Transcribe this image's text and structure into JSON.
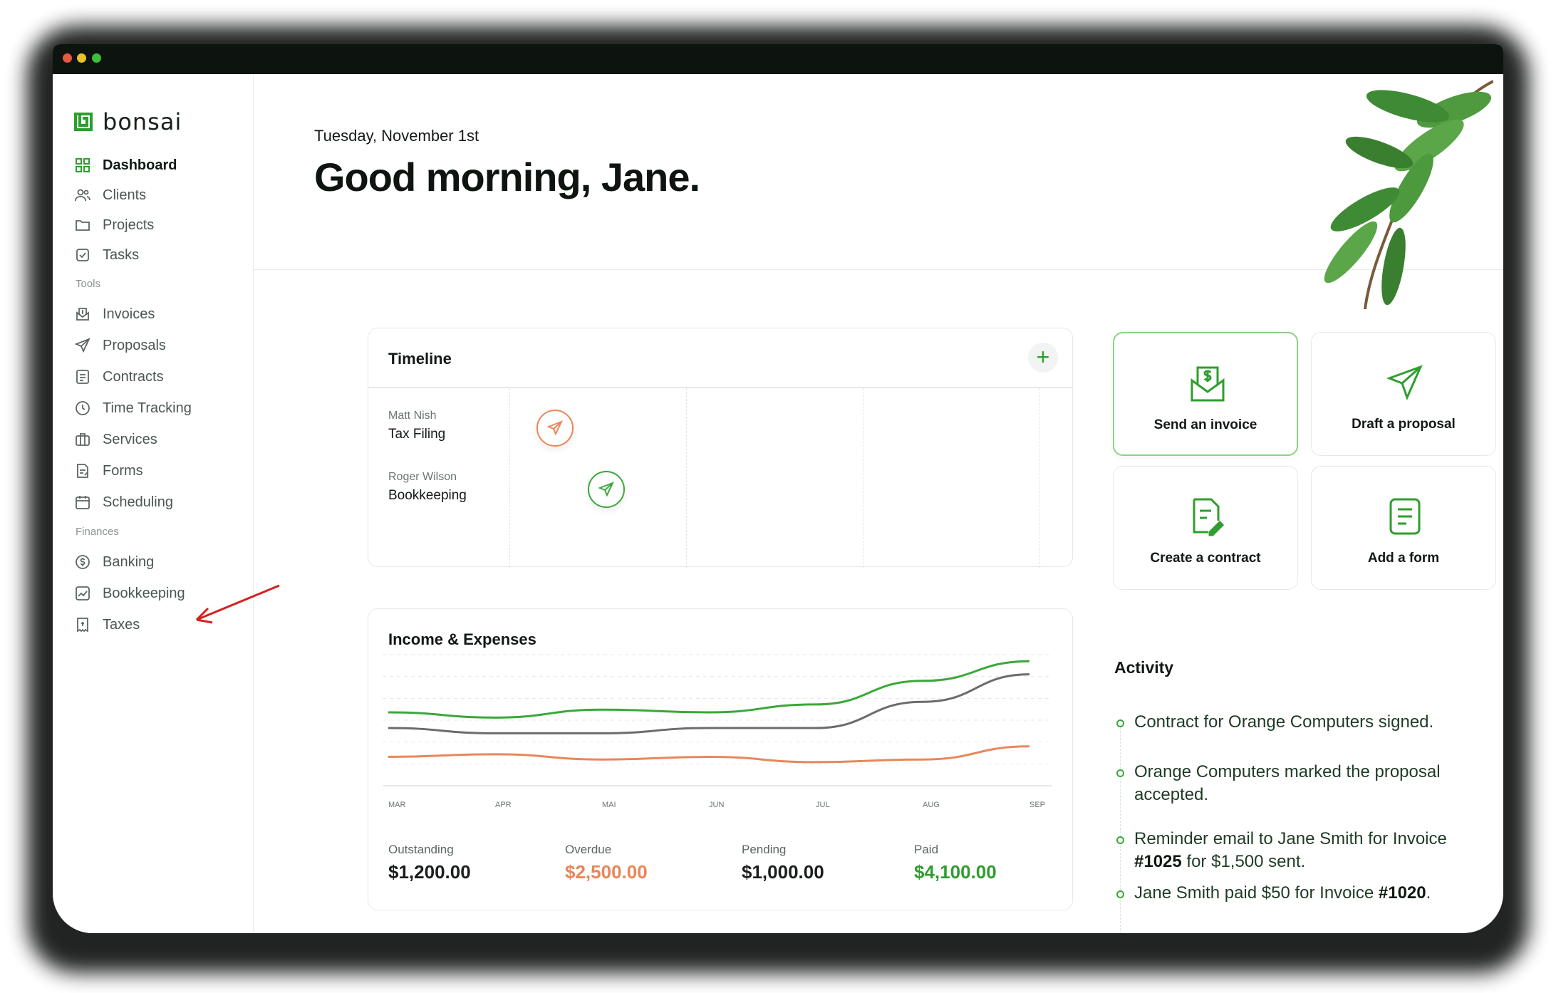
{
  "app": {
    "logo_text": "bonsai",
    "brand_color": "#2e9e2e"
  },
  "sidebar": {
    "main_items": [
      {
        "label": "Dashboard",
        "icon": "grid-icon",
        "active": true
      },
      {
        "label": "Clients",
        "icon": "users-icon"
      },
      {
        "label": "Projects",
        "icon": "folder-icon"
      },
      {
        "label": "Tasks",
        "icon": "checkbox-icon"
      }
    ],
    "tools_label": "Tools",
    "tools_items": [
      {
        "label": "Invoices",
        "icon": "invoice-icon"
      },
      {
        "label": "Proposals",
        "icon": "send-icon"
      },
      {
        "label": "Contracts",
        "icon": "document-icon"
      },
      {
        "label": "Time Tracking",
        "icon": "clock-icon"
      },
      {
        "label": "Services",
        "icon": "briefcase-icon"
      },
      {
        "label": "Forms",
        "icon": "form-icon"
      },
      {
        "label": "Scheduling",
        "icon": "calendar-icon"
      }
    ],
    "finances_label": "Finances",
    "finances_items": [
      {
        "label": "Banking",
        "icon": "dollar-circle-icon"
      },
      {
        "label": "Bookkeeping",
        "icon": "chart-icon"
      },
      {
        "label": "Taxes",
        "icon": "receipt-icon"
      }
    ]
  },
  "header": {
    "date": "Tuesday, November 1st",
    "greeting": "Good morning, Jane."
  },
  "timeline": {
    "title": "Timeline",
    "add_label": "+",
    "entries": [
      {
        "client": "Matt Nish",
        "task": "Tax Filing",
        "color": "#e8875a"
      },
      {
        "client": "Roger Wilson",
        "task": "Bookkeeping",
        "color": "#3aa83a"
      }
    ]
  },
  "income": {
    "title": "Income & Expenses",
    "stats": [
      {
        "label": "Outstanding",
        "value": "$1,200.00",
        "color": "#0f1a13"
      },
      {
        "label": "Overdue",
        "value": "$2,500.00",
        "color": "#e8875a"
      },
      {
        "label": "Pending",
        "value": "$1,000.00",
        "color": "#0f1a13"
      },
      {
        "label": "Paid",
        "value": "$4,100.00",
        "color": "#2e9e2e"
      }
    ]
  },
  "chart_data": {
    "type": "line",
    "x": [
      "MAR",
      "APR",
      "MAI",
      "JUN",
      "JUL",
      "AUG",
      "SEP"
    ],
    "series": [
      {
        "color": "#3aa83a",
        "values": [
          56,
          52,
          58,
          56,
          62,
          80,
          95
        ]
      },
      {
        "color": "#6a6d6b",
        "values": [
          44,
          40,
          40,
          44,
          44,
          64,
          85
        ]
      },
      {
        "color": "#e8875a",
        "values": [
          22,
          24,
          20,
          22,
          18,
          20,
          30
        ]
      }
    ],
    "ylim": [
      0,
      100
    ],
    "grid": true
  },
  "actions": [
    {
      "label": "Send an invoice",
      "icon": "invoice-send-icon",
      "primary": true
    },
    {
      "label": "Draft a proposal",
      "icon": "paper-plane-icon",
      "primary": false
    },
    {
      "label": "Create a contract",
      "icon": "contract-edit-icon",
      "primary": false
    },
    {
      "label": "Add a form",
      "icon": "form-lines-icon",
      "primary": false
    }
  ],
  "activity": {
    "title": "Activity",
    "items": [
      {
        "text": "Contract for Orange Computers signed."
      },
      {
        "text": "Orange Computers marked the proposal accepted."
      },
      {
        "pre": "Reminder email to Jane Smith for Invoice ",
        "bold": "#1025",
        "post": " for $1,500 sent."
      },
      {
        "pre": "Jane Smith paid $50 for Invoice ",
        "bold": "#1020",
        "post": "."
      }
    ]
  }
}
